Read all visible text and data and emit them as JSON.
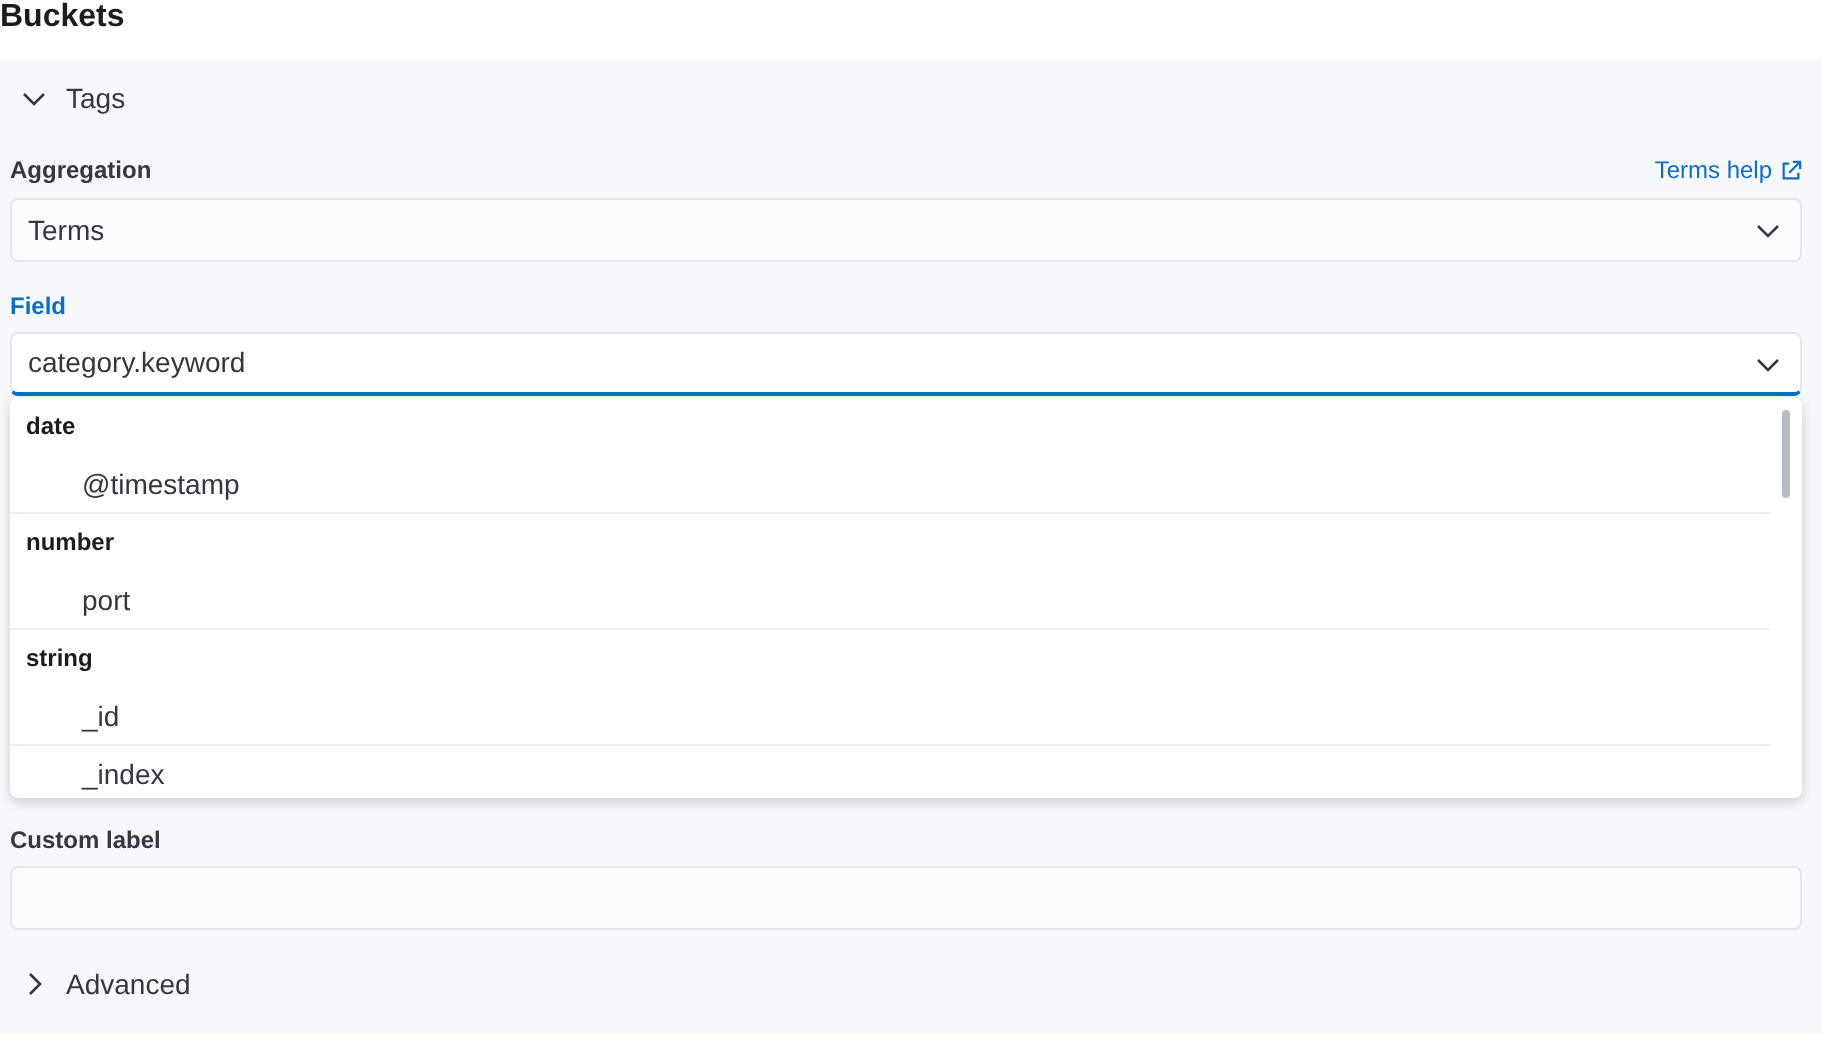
{
  "heading": "Buckets",
  "bucket": {
    "title": "Tags",
    "expanded": true
  },
  "aggregation": {
    "label": "Aggregation",
    "help_link": "Terms help",
    "value": "Terms"
  },
  "field": {
    "label": "Field",
    "focused": true,
    "value": "category.keyword",
    "open": true,
    "groups": [
      {
        "label": "date",
        "options": [
          "@timestamp"
        ]
      },
      {
        "label": "number",
        "options": [
          "port"
        ]
      },
      {
        "label": "string",
        "options": [
          "_id",
          "_index"
        ]
      }
    ]
  },
  "custom_label": {
    "label": "Custom label"
  },
  "advanced": {
    "title": "Advanced",
    "expanded": false
  }
}
